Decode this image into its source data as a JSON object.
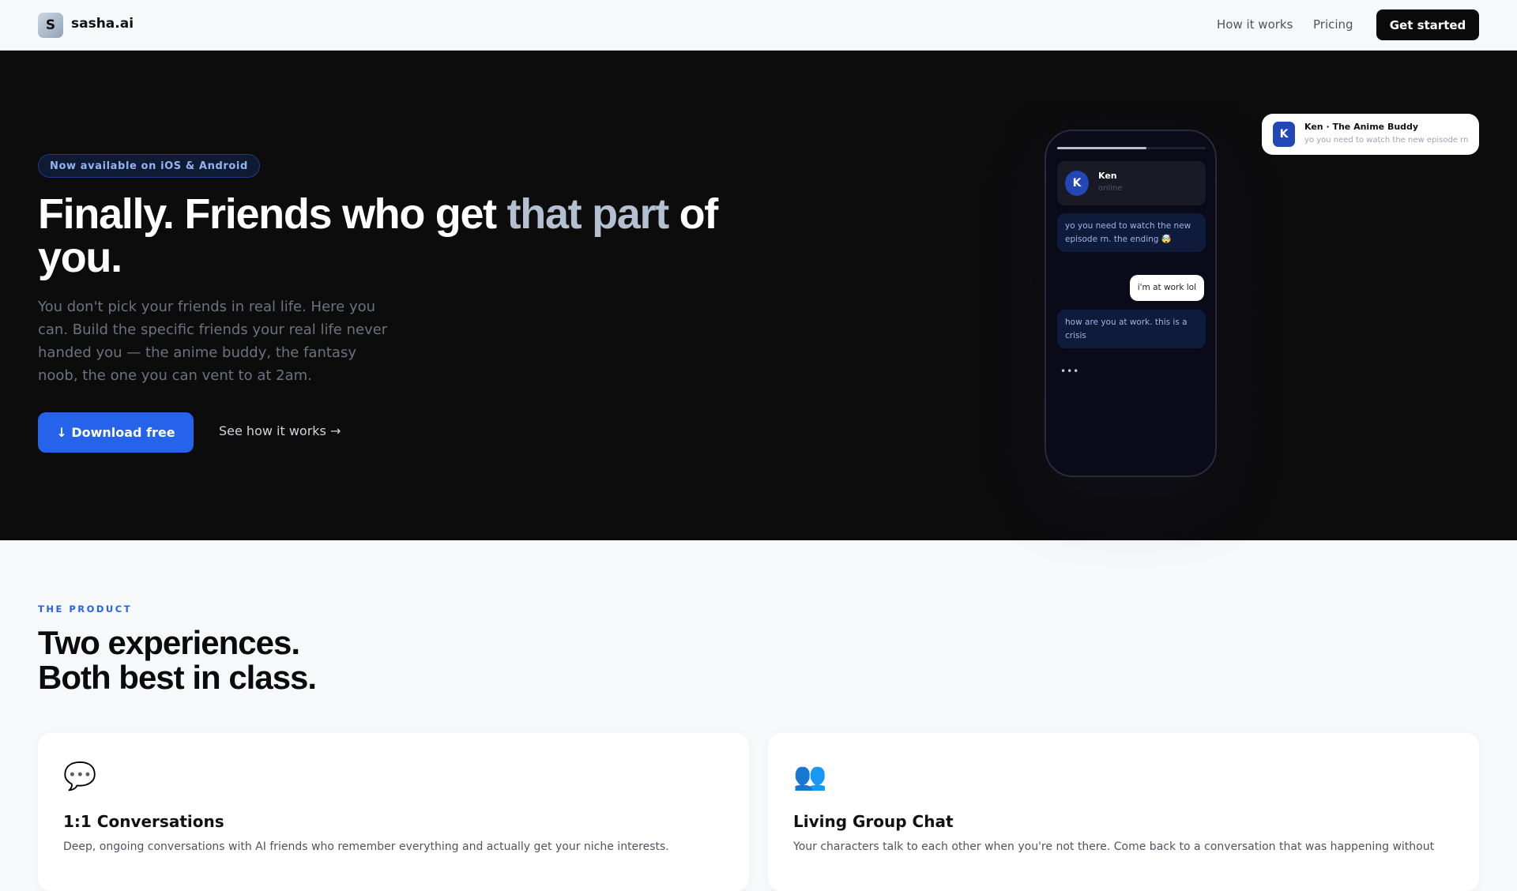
{
  "nav": {
    "logo_letter": "S",
    "brand": "sasha.ai",
    "links": [
      "How it works",
      "Pricing"
    ],
    "cta": "Get started"
  },
  "hero": {
    "badge": "Now available on iOS & Android",
    "title_a": "Finally. Friends who get ",
    "title_hl": "that part",
    "title_b": " of you.",
    "lead": "You don't pick your friends in real life. Here you can. Build the specific friends your real life never handed you — the anime buddy, the fantasy noob, the one you can vent to at 2am.",
    "download": "↓ Download free",
    "see": "See how it works →"
  },
  "phone": {
    "progress": 0.6,
    "avatar": "K",
    "name": "Ken",
    "status": "online",
    "messages": [
      "yo you need to watch the new episode rn. the ending 🤯",
      "i'm at work lol",
      "how are you at work. this is a crisis"
    ],
    "typing": "•••"
  },
  "notification": {
    "avatar": "K",
    "title": "Ken · The Anime Buddy",
    "text": "yo you need to watch the new episode rn"
  },
  "product": {
    "eyebrow": "THE PRODUCT",
    "title_1": "Two experiences.",
    "title_2": "Both best in class.",
    "cards": [
      {
        "icon": "💬",
        "title": "1:1 Conversations",
        "desc": "Deep, ongoing conversations with AI friends who remember everything and actually get your niche interests."
      },
      {
        "icon": "👥",
        "title": "Living Group Chat",
        "desc": "Your characters talk to each other when you're not there. Come back to a conversation that was happening without"
      }
    ]
  }
}
